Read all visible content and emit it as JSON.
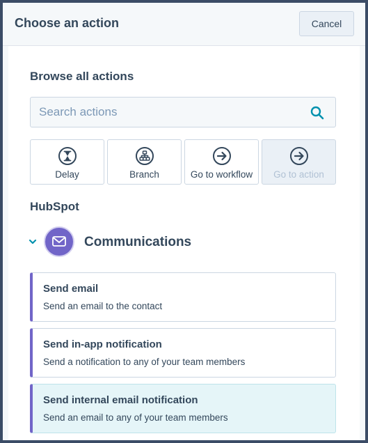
{
  "dialog": {
    "title": "Choose an action",
    "cancel_label": "Cancel"
  },
  "browse": {
    "heading": "Browse all actions",
    "search_placeholder": "Search actions",
    "search_value": ""
  },
  "quick_actions": [
    {
      "label": "Delay",
      "icon": "hourglass-icon",
      "enabled": true
    },
    {
      "label": "Branch",
      "icon": "branch-icon",
      "enabled": true
    },
    {
      "label": "Go to workflow",
      "icon": "arrow-right-circle-icon",
      "enabled": true
    },
    {
      "label": "Go to action",
      "icon": "arrow-right-circle-icon",
      "enabled": false
    }
  ],
  "group": {
    "heading": "HubSpot",
    "category": {
      "label": "Communications",
      "icon": "envelope-icon",
      "expanded": true
    },
    "actions": [
      {
        "title": "Send email",
        "description": "Send an email to the contact"
      },
      {
        "title": "Send in-app notification",
        "description": "Send a notification to any of your team members"
      },
      {
        "title": "Send internal email notification",
        "description": "Send an email to any of your team members"
      }
    ]
  },
  "colors": {
    "accent": "#7165c8",
    "text": "#33475b",
    "teal": "#0091ae",
    "frame": "#3b4c66"
  }
}
